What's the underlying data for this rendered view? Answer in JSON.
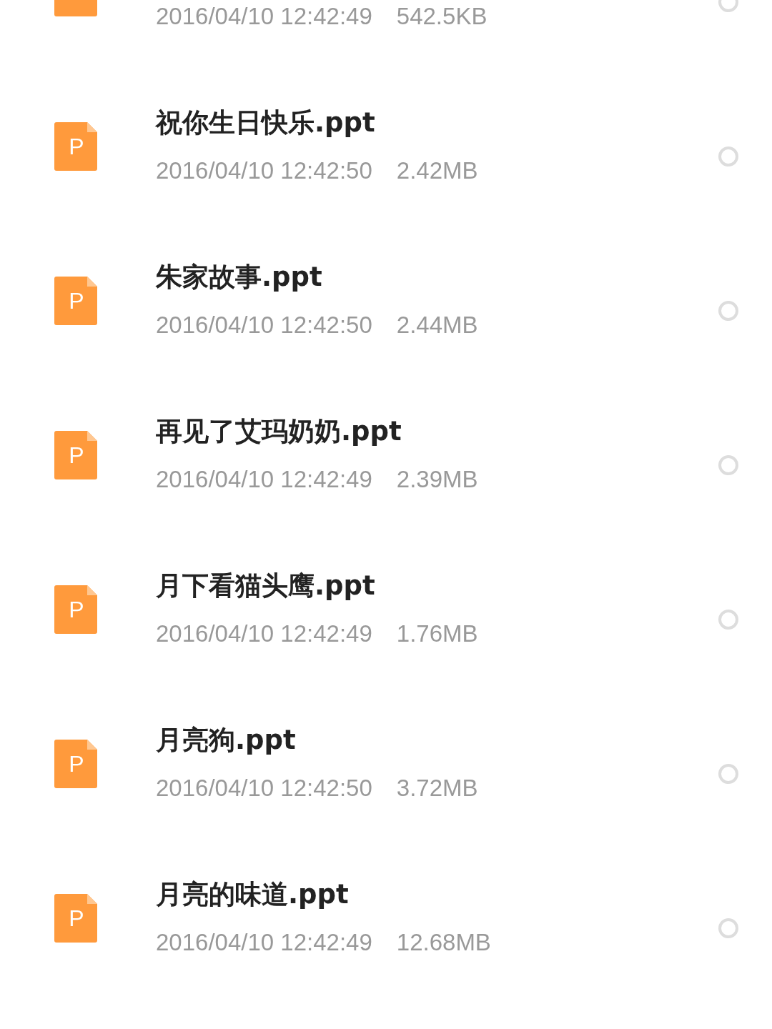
{
  "files": [
    {
      "meta": "2016/04/10 12:42:49",
      "size": "542.5KB",
      "selected": false
    },
    {
      "title": "祝你生日快乐.ppt",
      "meta": "2016/04/10 12:42:50",
      "size": "2.42MB",
      "selected": false
    },
    {
      "title": "朱家故事.ppt",
      "meta": "2016/04/10 12:42:50",
      "size": "2.44MB",
      "selected": false
    },
    {
      "title": "再见了艾玛奶奶.ppt",
      "meta": "2016/04/10 12:42:49",
      "size": "2.39MB",
      "selected": false
    },
    {
      "title": "月下看猫头鹰.ppt",
      "meta": "2016/04/10 12:42:49",
      "size": "1.76MB",
      "selected": false
    },
    {
      "title": "月亮狗.ppt",
      "meta": "2016/04/10 12:42:50",
      "size": "3.72MB",
      "selected": false
    },
    {
      "title": "月亮的味道.ppt",
      "meta": "2016/04/10 12:42:49",
      "size": "12.68MB",
      "selected": false
    }
  ],
  "icon_letter": [
    "P",
    "P",
    "P",
    "P",
    "P",
    "P"
  ]
}
